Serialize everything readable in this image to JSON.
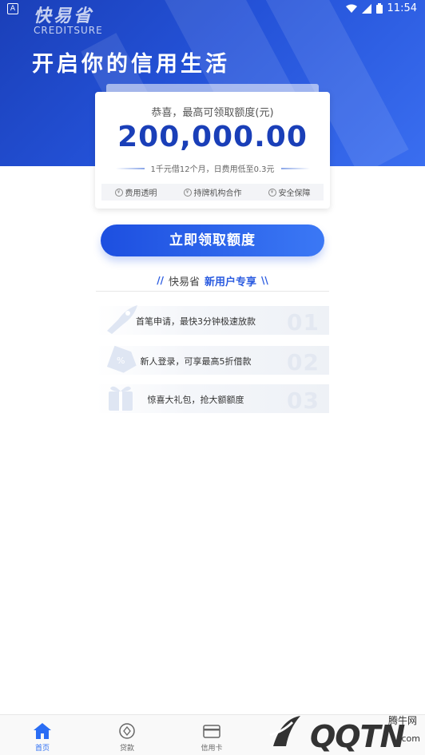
{
  "status_bar": {
    "left_icon": "A",
    "time": "11:54",
    "battery": "battery-icon"
  },
  "brand": {
    "cn": "快易省",
    "en": "CREDITSURE"
  },
  "hero": {
    "slogan": "开启你的信用生活"
  },
  "quota_card": {
    "subtitle": "恭喜，最高可领取额度(元)",
    "amount": "200,000.00",
    "note": "1千元借12个月，日费用低至0.3元",
    "features": [
      "费用透明",
      "持牌机构合作",
      "安全保障"
    ]
  },
  "cta": {
    "label": "立即领取额度"
  },
  "exclusive": {
    "brand": "快易省",
    "highlight": "新用户专享"
  },
  "benefits": [
    {
      "text": "首笔申请，最快3分钟极速放款",
      "num": "01"
    },
    {
      "text": "新人登录，可享最高5折借款",
      "num": "02"
    },
    {
      "text": "惊喜大礼包，抢大额额度",
      "num": "03"
    }
  ],
  "tabbar": {
    "tabs": [
      {
        "label": "首页"
      },
      {
        "label": "贷款"
      },
      {
        "label": "信用卡"
      }
    ]
  },
  "watermark": {
    "big": "QQTN",
    "small": "腾牛网",
    "com": ".com"
  },
  "colors": {
    "primary": "#2452d8",
    "accent": "#2a6df4",
    "hero_dark": "#1a3fb8"
  }
}
